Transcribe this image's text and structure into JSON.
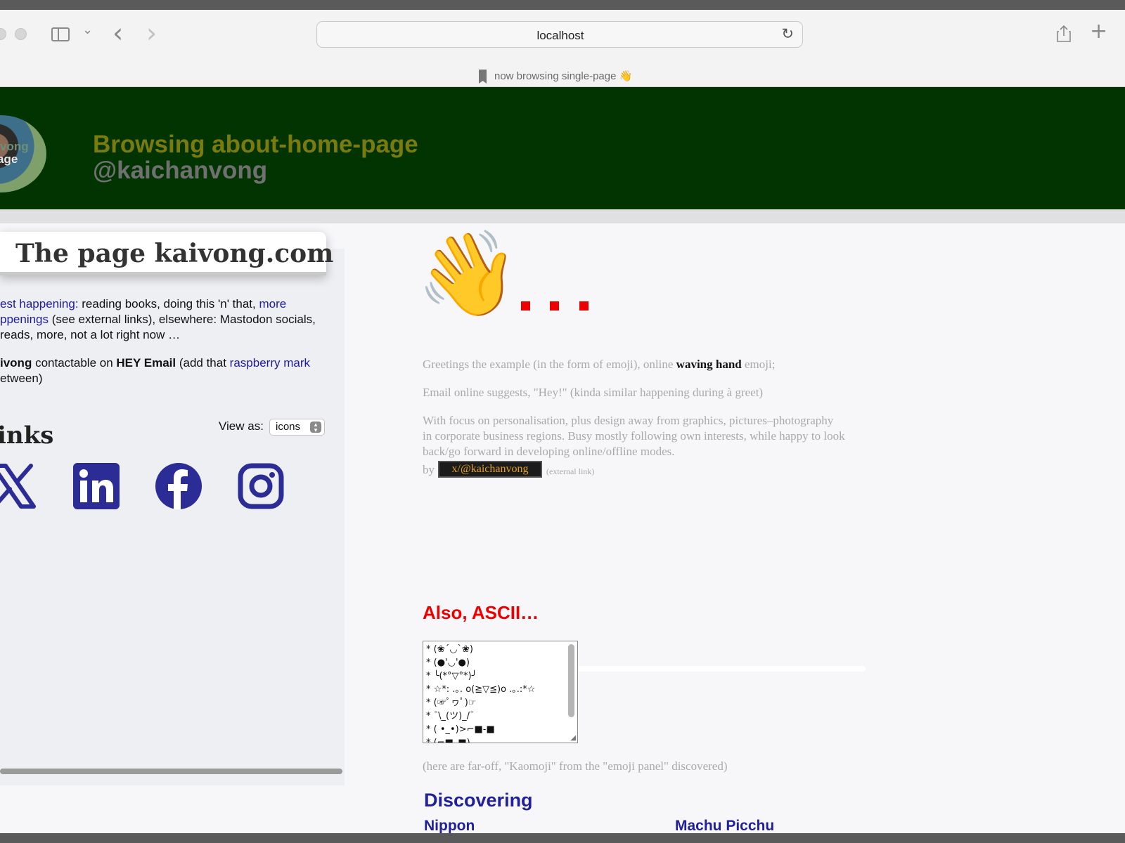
{
  "browser": {
    "url": "localhost",
    "tab_title": "now browsing single-page 👋",
    "reload_glyph": "↻",
    "icons": [
      "sidebar-icon",
      "chevron-down-icon",
      "back-icon",
      "forward-icon",
      "share-icon",
      "new-tab-icon",
      "reload-icon"
    ],
    "chevron_glyph": "⌄",
    "back_glyph": "‹",
    "forward_glyph": "›",
    "new_tab_glyph": "+"
  },
  "header": {
    "avatar_text_1": "vong",
    "avatar_text_2": "age",
    "title": "Browsing about-home-page",
    "handle": "@kaichanvong",
    "background": "#013400",
    "title_color": "#7b7a0e"
  },
  "panel": {
    "title": "The page kaivong.com",
    "line1_link": "est happening:",
    "line1_text": " reading books, doing this 'n' that, ",
    "line1_link2": "more",
    "line2_link": "ppenings",
    "line2_text": " (see external links), elsewhere: Mastodon socials,",
    "line3_text": "reads, more, not a lot right now …",
    "line4_bold": "ivong",
    "line4_text": " contactable on ",
    "line4_bold2": "HEY Email",
    "line4_text2": " (add that ",
    "line4_link": "raspberry mark",
    "line5_text": "etween)",
    "links_heading": "inks",
    "view_as_label": "View as:",
    "view_as_value": "icons",
    "social_icons": [
      "x-icon",
      "linkedin-icon",
      "facebook-icon",
      "instagram-icon"
    ],
    "icon_color": "#2c2c96"
  },
  "main": {
    "wave_emoji": "👋",
    "para1_a": "Greetings the example (in the form of emoji), online ",
    "para1_bold": "waving hand",
    "para1_b": " emoji;",
    "para2": "Email online suggests, \"Hey!\" (kinda similar happening during à greet)",
    "para3_line1": "With focus on personalisation, plus design away from graphics, pictures–photography",
    "para3_line2": "in corporate business regions. Busy mostly following own interests, while happy to look",
    "para3_line3": "back/go forward in developing online/offline modes.",
    "by_label": "by",
    "by_link": "x/@kaichanvong",
    "external_note": "(external link)",
    "ascii_heading": "Also, ASCII…",
    "ascii_lines": [
      "* (❀´◡`❀)",
      "* (●'◡'●)",
      "*  ╰(*°▽°*)╯",
      "* ☆*: .｡. o(≧▽≦)o .｡.:*☆",
      "* (☞ﾟヮﾟ)☞",
      "* ¯\\_(ツ)_/¯",
      "* ( •_•)>⌐■-■",
      "* (⌐■_■)"
    ],
    "kaomoji_note": "(here are far-off, \"Kaomoji\" from the \"emoji panel\" discovered)",
    "discovering_heading": "Discovering",
    "discover_left": "Nippon",
    "discover_right": "Machu Picchu",
    "accent_red": "#ee0000",
    "accent_blue": "#20209a"
  }
}
